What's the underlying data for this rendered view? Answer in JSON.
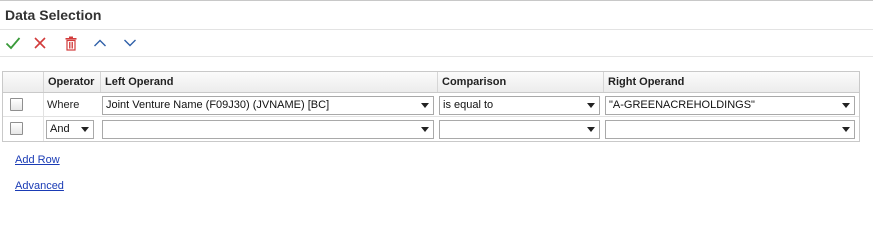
{
  "title": "Data Selection",
  "toolbar": {
    "icons": [
      "check-icon",
      "close-icon",
      "trash-icon",
      "chevron-up-icon",
      "chevron-down-icon"
    ],
    "colors": {
      "check": "#3a9a3a",
      "close": "#d23b3b",
      "trash": "#d23b3b",
      "chevrons": "#2f5fa8"
    }
  },
  "grid": {
    "headers": {
      "operator": "Operator",
      "left_operand": "Left Operand",
      "comparison": "Comparison",
      "right_operand": "Right Operand"
    },
    "rows": [
      {
        "operator": "Where",
        "left_operand": "Joint Venture Name (F09J30) (JVNAME) [BC]",
        "comparison": "is equal to",
        "right_operand": "\"A-GREENACREHOLDINGS\""
      },
      {
        "operator": "And",
        "left_operand": "",
        "comparison": "",
        "right_operand": ""
      }
    ]
  },
  "links": {
    "add_row": "Add Row",
    "advanced": "Advanced"
  }
}
